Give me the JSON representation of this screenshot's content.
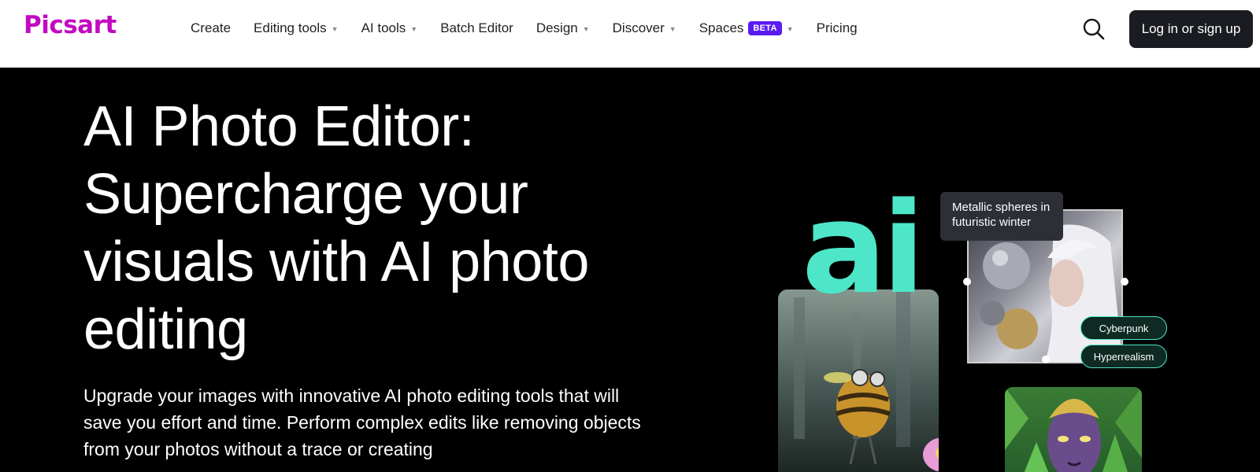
{
  "header": {
    "logo": "Picsart",
    "nav": [
      {
        "label": "Create",
        "dropdown": false
      },
      {
        "label": "Editing tools",
        "dropdown": true
      },
      {
        "label": "AI tools",
        "dropdown": true
      },
      {
        "label": "Batch Editor",
        "dropdown": false
      },
      {
        "label": "Design",
        "dropdown": true
      },
      {
        "label": "Discover",
        "dropdown": true
      },
      {
        "label": "Spaces",
        "badge": "BETA",
        "dropdown": true
      },
      {
        "label": "Pricing",
        "dropdown": false
      }
    ],
    "search_icon": "search-icon",
    "login_label": "Log in or sign up"
  },
  "hero": {
    "title": "AI Photo Editor: Supercharge your visuals with AI photo editing",
    "description": "Upgrade your images with innovative AI photo editing tools that will save you effort and time. Perform complex edits like removing objects from your photos without a trace or creating"
  },
  "art": {
    "ai_text": "ai",
    "prompt": "Metallic spheres in futuristic winter",
    "tags": [
      "Cyberpunk",
      "Hyperrealism"
    ]
  },
  "colors": {
    "brand": "#c209c1",
    "accent": "#4de6c8",
    "badge": "#5a1cf0",
    "button_dark": "#1a1c22"
  }
}
